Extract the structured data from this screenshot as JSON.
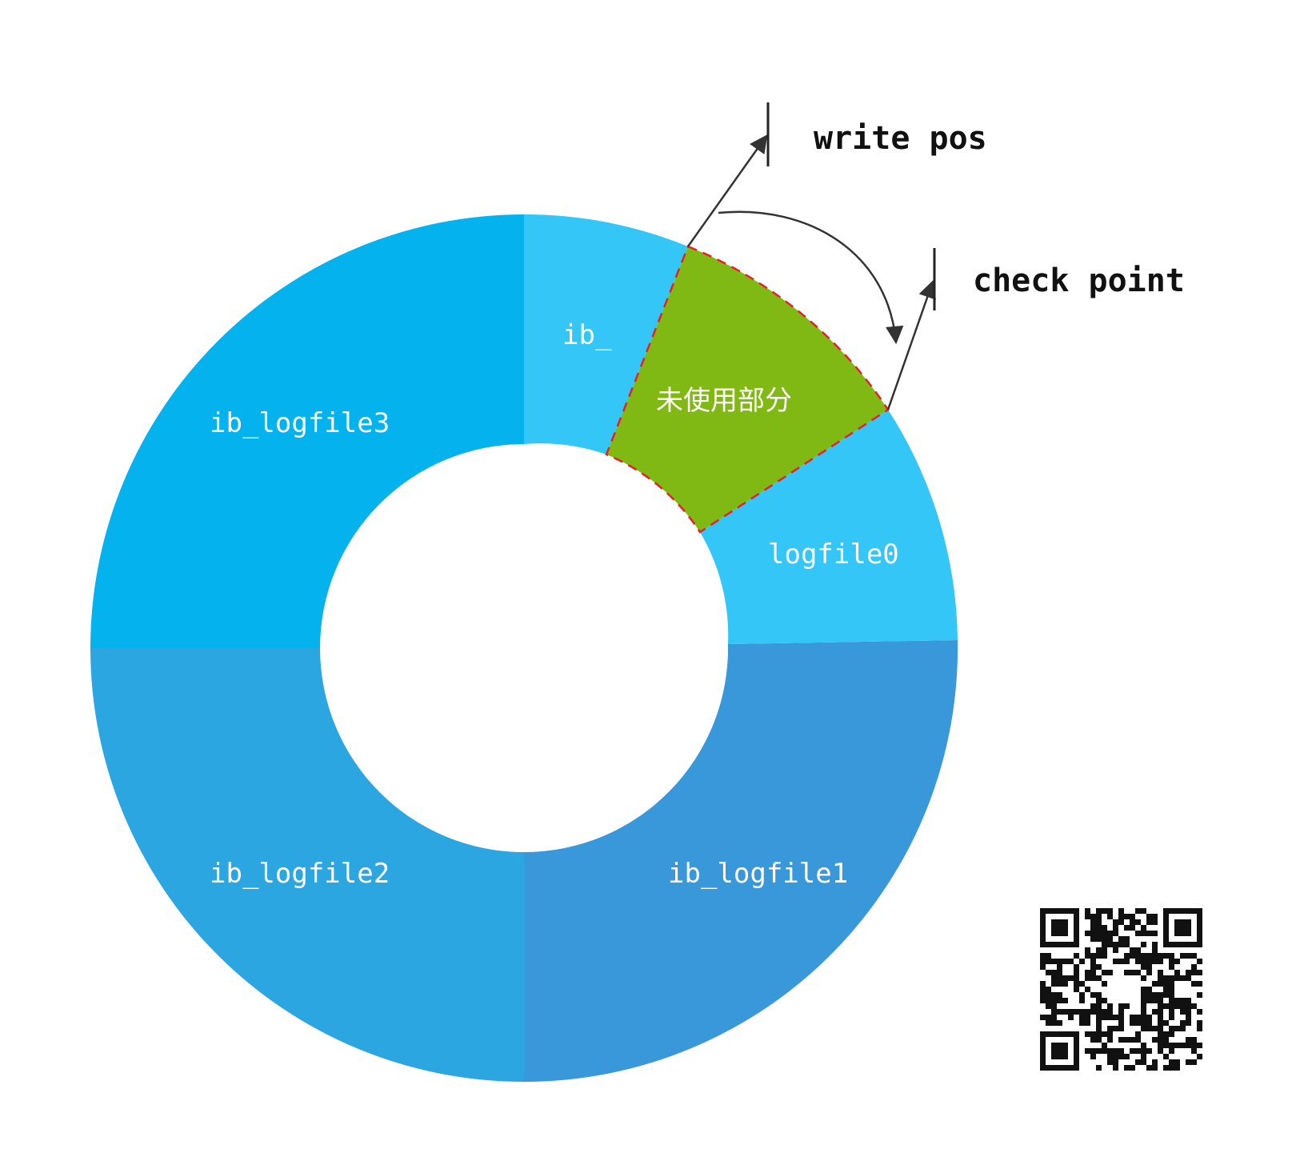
{
  "diagram": {
    "segments": [
      {
        "id": "ib_logfile0",
        "label_a": "ib_",
        "label_b": "logfile0",
        "color": "#33c6f6"
      },
      {
        "id": "unused",
        "label": "未使用部分",
        "color": "#80b913",
        "border_color": "#e8202a"
      },
      {
        "id": "ib_logfile1",
        "label": "ib_logfile1",
        "color": "#3898da"
      },
      {
        "id": "ib_logfile2",
        "label": "ib_logfile2",
        "color": "#2ba6e0"
      },
      {
        "id": "ib_logfile3",
        "label": "ib_logfile3",
        "color": "#04b2ed"
      }
    ],
    "markers": {
      "write_pos": "write pos",
      "check_point": "check point"
    },
    "decorations": {
      "qr_code": "qr-code-image"
    }
  }
}
